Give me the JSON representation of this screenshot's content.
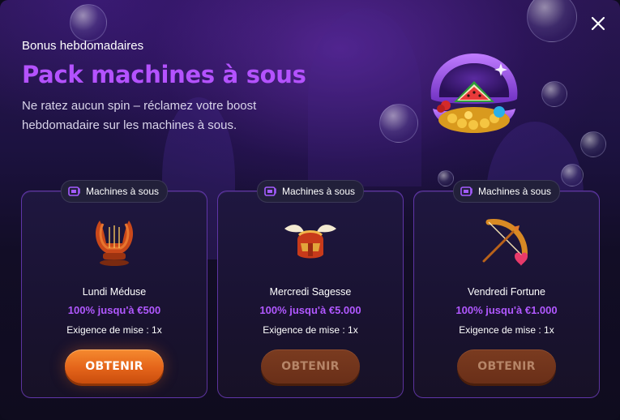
{
  "modal": {
    "subtitle": "Bonus hebdomadaires",
    "title": "Pack machines à sous",
    "description": "Ne ratez aucun spin – réclamez votre boost hebdomadaire sur les machines à sous.",
    "close_icon": "close-icon",
    "hero_icon": "treasure-shell-watermelon-icon"
  },
  "colors": {
    "accent": "#b452ff",
    "button_active": "#e4641a",
    "button_disabled": "#6a2f18"
  },
  "cards": [
    {
      "tag": "Machines à sous",
      "tag_icon": "slot-machine-icon",
      "icon": "lyre-icon",
      "name": "Lundi Méduse",
      "offer": "100% jusqu'à €500",
      "wager": "Exigence de mise : 1x",
      "button": "OBTENIR",
      "button_state": "active"
    },
    {
      "tag": "Machines à sous",
      "tag_icon": "slot-machine-icon",
      "icon": "winged-helmet-icon",
      "name": "Mercredi Sagesse",
      "offer": "100% jusqu'à €5.000",
      "wager": "Exigence de mise : 1x",
      "button": "OBTENIR",
      "button_state": "disabled"
    },
    {
      "tag": "Machines à sous",
      "tag_icon": "slot-machine-icon",
      "icon": "bow-and-arrow-icon",
      "name": "Vendredi Fortune",
      "offer": "100% jusqu'à €1.000",
      "wager": "Exigence de mise : 1x",
      "button": "OBTENIR",
      "button_state": "disabled"
    }
  ]
}
